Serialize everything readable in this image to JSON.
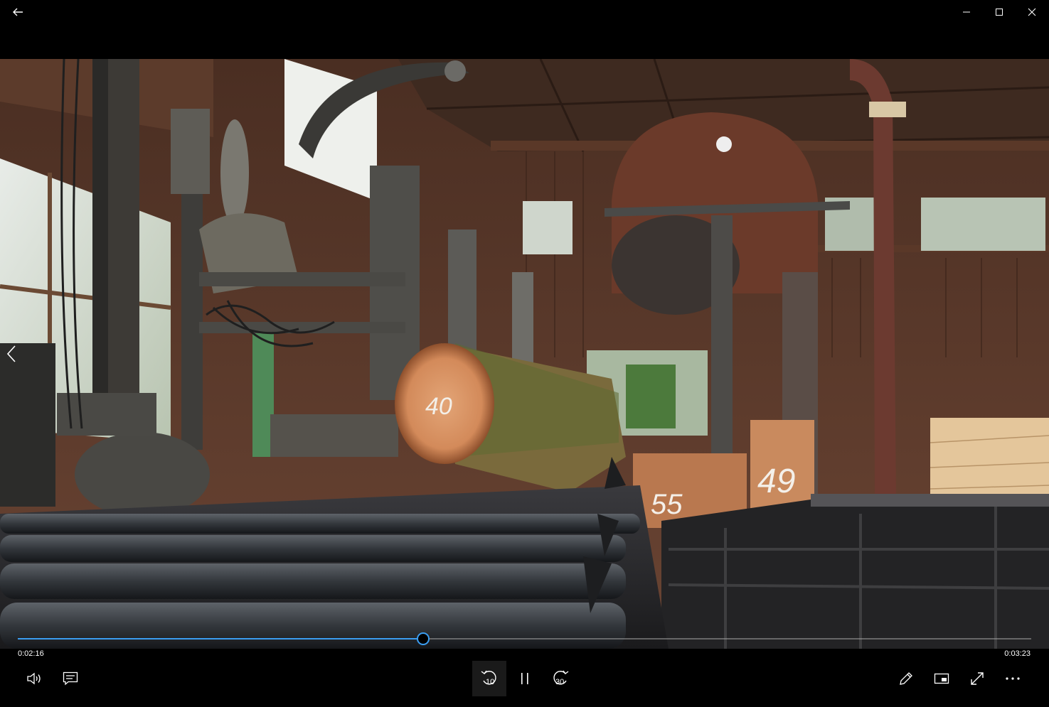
{
  "app": {
    "window_controls": {
      "back": "back-arrow-icon",
      "minimize": "minimize-icon",
      "maximize": "maximize-icon",
      "close": "close-icon"
    }
  },
  "video": {
    "frame_labels": {
      "log_mark": "40",
      "beam_mark": "49",
      "beam_mark_2": "55"
    }
  },
  "player": {
    "current_time": "0:02:16",
    "total_time": "0:03:23",
    "progress": 0.4
  },
  "controls": {
    "skip_back_seconds": "10",
    "skip_forward_seconds": "30",
    "icons": {
      "volume": "volume-icon",
      "captions": "captions-icon",
      "skip_back": "skip-back-icon",
      "play_pause": "pause-icon",
      "skip_forward": "skip-forward-icon",
      "edit": "edit-pencil-icon",
      "mini_view": "mini-view-icon",
      "fullscreen": "fullscreen-icon",
      "more": "more-options-icon"
    }
  },
  "colors": {
    "accent": "#3b9df1",
    "background": "#000000"
  }
}
